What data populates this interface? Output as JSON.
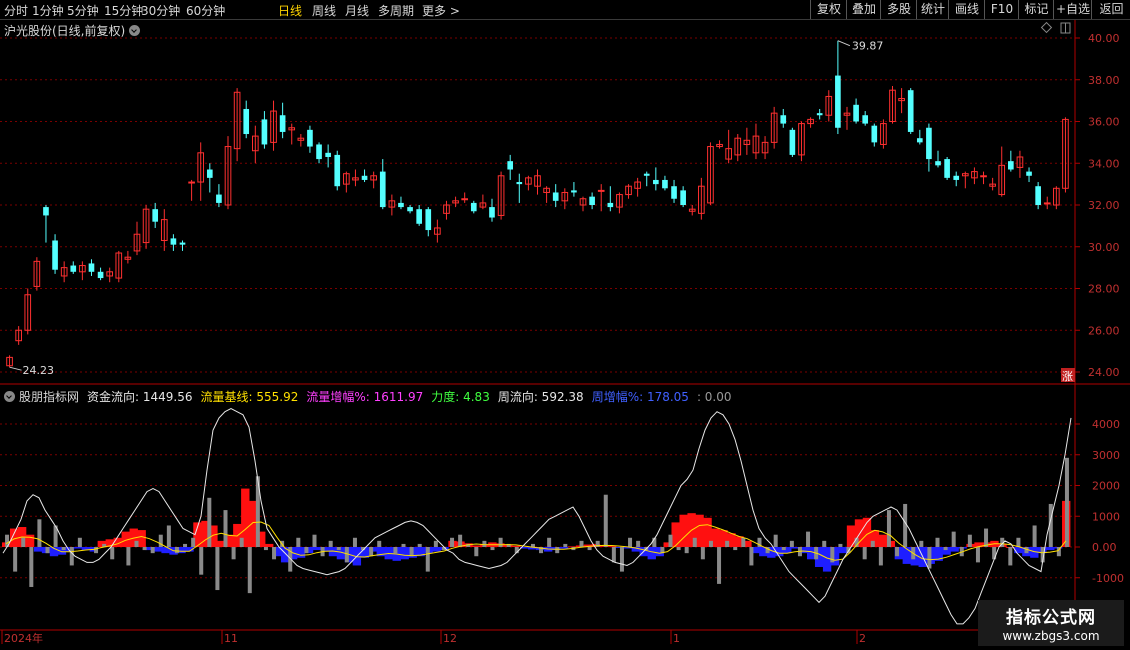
{
  "toolbar": {
    "periods": [
      "分时",
      "1分钟",
      "5分钟",
      "15分钟",
      "30分钟",
      "60分钟",
      "日线",
      "周线",
      "月线",
      "多周期",
      "更多 >"
    ],
    "active_period": "日线",
    "right_buttons": [
      "复权",
      "叠加",
      "多股",
      "统计",
      "画线",
      "F10",
      "标记",
      "+自选",
      "返回"
    ]
  },
  "main_chart": {
    "title": "沪光股份(日线,前复权)",
    "price_labels": [
      "40.00",
      "38.00",
      "36.00",
      "34.00",
      "32.00",
      "30.00",
      "28.00",
      "26.00",
      "24.00"
    ],
    "high_annotation": "39.87",
    "low_annotation": "24.23",
    "zhang_badge": "涨"
  },
  "indicator": {
    "source": "股朋指标网",
    "items": [
      {
        "label": "资金流向:",
        "value": "1449.56",
        "color": "#e6e6e6"
      },
      {
        "label": "流量基线:",
        "value": "555.92",
        "color": "#ffe000"
      },
      {
        "label": "流量增幅%:",
        "value": "1611.97",
        "color": "#ff40ff"
      },
      {
        "label": "力度:",
        "value": "4.83",
        "color": "#40ff40"
      },
      {
        "label": "周流向:",
        "value": "592.38",
        "color": "#e6e6e6"
      },
      {
        "label": "周增幅%:",
        "value": "178.05",
        "color": "#4060ff"
      },
      {
        "label": ":",
        "value": "0.00",
        "color": "#999999"
      }
    ],
    "axis_labels": [
      "4000",
      "3000",
      "2000",
      "1000",
      "0.00",
      "-1000"
    ]
  },
  "date_labels": [
    "2024年",
    "11",
    "12",
    "1",
    "2"
  ],
  "watermark": {
    "line1": "指标公式网",
    "line2": "www.zbgs3.com"
  },
  "colors": {
    "up": "#ff3030",
    "down": "#54ffff",
    "grid": "#7a0000",
    "frame": "#b00000"
  },
  "chart_data": {
    "type": "candlestick",
    "price_ylim": [
      23.5,
      40.5
    ],
    "flow_ylim": [
      -2600,
      4900
    ],
    "candles": [
      {
        "o": 24.3,
        "h": 24.8,
        "l": 24.23,
        "c": 24.7
      },
      {
        "o": 25.5,
        "h": 26.2,
        "l": 25.3,
        "c": 26.0
      },
      {
        "o": 26.0,
        "h": 28.0,
        "l": 25.8,
        "c": 27.7
      },
      {
        "o": 28.1,
        "h": 29.5,
        "l": 27.9,
        "c": 29.3
      },
      {
        "o": 31.9,
        "h": 32.0,
        "l": 30.2,
        "c": 31.5
      },
      {
        "o": 30.3,
        "h": 30.6,
        "l": 28.7,
        "c": 28.9
      },
      {
        "o": 28.6,
        "h": 29.3,
        "l": 28.3,
        "c": 29.0
      },
      {
        "o": 29.1,
        "h": 29.3,
        "l": 28.7,
        "c": 28.8
      },
      {
        "o": 28.8,
        "h": 29.3,
        "l": 28.4,
        "c": 29.1
      },
      {
        "o": 29.2,
        "h": 29.4,
        "l": 28.6,
        "c": 28.8
      },
      {
        "o": 28.8,
        "h": 29.0,
        "l": 28.4,
        "c": 28.5
      },
      {
        "o": 28.6,
        "h": 29.0,
        "l": 28.3,
        "c": 28.8
      },
      {
        "o": 28.5,
        "h": 29.8,
        "l": 28.3,
        "c": 29.7
      },
      {
        "o": 29.4,
        "h": 29.8,
        "l": 29.2,
        "c": 29.5
      },
      {
        "o": 29.8,
        "h": 31.2,
        "l": 29.6,
        "c": 30.6
      },
      {
        "o": 30.2,
        "h": 32.0,
        "l": 29.9,
        "c": 31.8
      },
      {
        "o": 31.8,
        "h": 32.1,
        "l": 30.9,
        "c": 31.2
      },
      {
        "o": 30.3,
        "h": 31.8,
        "l": 29.8,
        "c": 31.3
      },
      {
        "o": 30.4,
        "h": 30.6,
        "l": 29.8,
        "c": 30.1
      },
      {
        "o": 30.2,
        "h": 30.3,
        "l": 29.8,
        "c": 30.1
      },
      {
        "o": 33.1,
        "h": 33.2,
        "l": 32.2,
        "c": 33.1
      },
      {
        "o": 33.1,
        "h": 35.0,
        "l": 32.2,
        "c": 34.5
      },
      {
        "o": 33.7,
        "h": 34.0,
        "l": 32.6,
        "c": 33.3
      },
      {
        "o": 32.5,
        "h": 33.0,
        "l": 31.9,
        "c": 32.1
      },
      {
        "o": 32.0,
        "h": 35.3,
        "l": 31.8,
        "c": 34.8
      },
      {
        "o": 34.7,
        "h": 37.6,
        "l": 34.1,
        "c": 37.4
      },
      {
        "o": 36.6,
        "h": 37.0,
        "l": 35.2,
        "c": 35.4
      },
      {
        "o": 34.6,
        "h": 35.8,
        "l": 34.0,
        "c": 35.3
      },
      {
        "o": 36.1,
        "h": 36.5,
        "l": 34.7,
        "c": 34.9
      },
      {
        "o": 35.0,
        "h": 37.0,
        "l": 34.6,
        "c": 36.5
      },
      {
        "o": 36.3,
        "h": 36.9,
        "l": 35.2,
        "c": 35.5
      },
      {
        "o": 35.6,
        "h": 35.9,
        "l": 34.9,
        "c": 35.7
      },
      {
        "o": 35.1,
        "h": 35.4,
        "l": 34.8,
        "c": 35.2
      },
      {
        "o": 35.6,
        "h": 35.8,
        "l": 34.5,
        "c": 34.8
      },
      {
        "o": 34.9,
        "h": 35.0,
        "l": 34.0,
        "c": 34.2
      },
      {
        "o": 34.5,
        "h": 34.9,
        "l": 33.8,
        "c": 34.3
      },
      {
        "o": 34.4,
        "h": 34.6,
        "l": 32.7,
        "c": 32.9
      },
      {
        "o": 33.0,
        "h": 33.6,
        "l": 32.6,
        "c": 33.5
      },
      {
        "o": 33.2,
        "h": 33.7,
        "l": 32.9,
        "c": 33.3
      },
      {
        "o": 33.4,
        "h": 33.7,
        "l": 33.1,
        "c": 33.2
      },
      {
        "o": 33.2,
        "h": 33.6,
        "l": 32.8,
        "c": 33.4
      },
      {
        "o": 33.6,
        "h": 34.2,
        "l": 31.8,
        "c": 31.9
      },
      {
        "o": 31.9,
        "h": 32.5,
        "l": 31.5,
        "c": 32.2
      },
      {
        "o": 32.1,
        "h": 32.4,
        "l": 31.8,
        "c": 31.9
      },
      {
        "o": 31.9,
        "h": 32.0,
        "l": 31.6,
        "c": 31.7
      },
      {
        "o": 31.8,
        "h": 32.0,
        "l": 31.0,
        "c": 31.1
      },
      {
        "o": 31.8,
        "h": 31.9,
        "l": 30.5,
        "c": 30.8
      },
      {
        "o": 30.6,
        "h": 31.3,
        "l": 30.2,
        "c": 30.9
      },
      {
        "o": 31.6,
        "h": 32.2,
        "l": 31.3,
        "c": 32.0
      },
      {
        "o": 32.1,
        "h": 32.4,
        "l": 31.9,
        "c": 32.2
      },
      {
        "o": 32.3,
        "h": 32.6,
        "l": 32.1,
        "c": 32.3
      },
      {
        "o": 32.1,
        "h": 32.2,
        "l": 31.6,
        "c": 31.7
      },
      {
        "o": 31.9,
        "h": 32.5,
        "l": 31.8,
        "c": 32.1
      },
      {
        "o": 31.9,
        "h": 32.3,
        "l": 31.2,
        "c": 31.4
      },
      {
        "o": 31.5,
        "h": 33.6,
        "l": 31.3,
        "c": 33.4
      },
      {
        "o": 34.1,
        "h": 34.4,
        "l": 33.2,
        "c": 33.7
      },
      {
        "o": 33.1,
        "h": 33.5,
        "l": 32.1,
        "c": 33.0
      },
      {
        "o": 33.0,
        "h": 33.4,
        "l": 32.7,
        "c": 33.3
      },
      {
        "o": 32.9,
        "h": 33.7,
        "l": 32.5,
        "c": 33.4
      },
      {
        "o": 32.6,
        "h": 32.9,
        "l": 32.1,
        "c": 32.8
      },
      {
        "o": 32.6,
        "h": 33.0,
        "l": 31.9,
        "c": 32.2
      },
      {
        "o": 32.2,
        "h": 32.8,
        "l": 31.8,
        "c": 32.6
      },
      {
        "o": 32.7,
        "h": 33.1,
        "l": 32.4,
        "c": 32.6
      },
      {
        "o": 32.0,
        "h": 32.4,
        "l": 31.7,
        "c": 32.3
      },
      {
        "o": 32.4,
        "h": 32.6,
        "l": 31.8,
        "c": 32.0
      },
      {
        "o": 32.7,
        "h": 33.0,
        "l": 31.7,
        "c": 32.7
      },
      {
        "o": 32.1,
        "h": 32.9,
        "l": 31.7,
        "c": 31.9
      },
      {
        "o": 31.9,
        "h": 32.6,
        "l": 31.6,
        "c": 32.5
      },
      {
        "o": 32.5,
        "h": 33.0,
        "l": 32.3,
        "c": 32.9
      },
      {
        "o": 32.8,
        "h": 33.3,
        "l": 32.4,
        "c": 33.1
      },
      {
        "o": 33.5,
        "h": 33.6,
        "l": 32.9,
        "c": 33.4
      },
      {
        "o": 33.2,
        "h": 33.8,
        "l": 32.7,
        "c": 33.0
      },
      {
        "o": 33.2,
        "h": 33.4,
        "l": 32.7,
        "c": 32.8
      },
      {
        "o": 32.9,
        "h": 33.2,
        "l": 32.1,
        "c": 32.3
      },
      {
        "o": 32.7,
        "h": 32.9,
        "l": 31.9,
        "c": 32.0
      },
      {
        "o": 31.7,
        "h": 32.0,
        "l": 31.5,
        "c": 31.8
      },
      {
        "o": 31.6,
        "h": 33.3,
        "l": 31.3,
        "c": 32.9
      },
      {
        "o": 32.1,
        "h": 35.0,
        "l": 32.0,
        "c": 34.8
      },
      {
        "o": 34.8,
        "h": 35.1,
        "l": 34.7,
        "c": 34.9
      },
      {
        "o": 34.2,
        "h": 35.6,
        "l": 34.0,
        "c": 34.7
      },
      {
        "o": 34.4,
        "h": 35.4,
        "l": 34.1,
        "c": 35.2
      },
      {
        "o": 34.9,
        "h": 35.7,
        "l": 34.4,
        "c": 35.1
      },
      {
        "o": 34.5,
        "h": 35.9,
        "l": 34.2,
        "c": 35.3
      },
      {
        "o": 34.5,
        "h": 35.3,
        "l": 34.2,
        "c": 35.0
      },
      {
        "o": 35.0,
        "h": 36.7,
        "l": 34.7,
        "c": 36.4
      },
      {
        "o": 36.3,
        "h": 36.6,
        "l": 35.7,
        "c": 35.9
      },
      {
        "o": 35.6,
        "h": 35.7,
        "l": 34.3,
        "c": 34.4
      },
      {
        "o": 34.4,
        "h": 36.0,
        "l": 34.1,
        "c": 35.9
      },
      {
        "o": 35.9,
        "h": 36.2,
        "l": 35.7,
        "c": 36.1
      },
      {
        "o": 36.4,
        "h": 36.6,
        "l": 36.1,
        "c": 36.3
      },
      {
        "o": 36.3,
        "h": 37.5,
        "l": 36.0,
        "c": 37.2
      },
      {
        "o": 38.2,
        "h": 39.87,
        "l": 35.4,
        "c": 35.7
      },
      {
        "o": 36.3,
        "h": 36.7,
        "l": 35.6,
        "c": 36.4
      },
      {
        "o": 36.8,
        "h": 37.1,
        "l": 35.9,
        "c": 36.0
      },
      {
        "o": 36.3,
        "h": 36.5,
        "l": 35.8,
        "c": 35.9
      },
      {
        "o": 35.8,
        "h": 35.9,
        "l": 34.8,
        "c": 35.0
      },
      {
        "o": 34.9,
        "h": 36.1,
        "l": 34.7,
        "c": 35.9
      },
      {
        "o": 36.0,
        "h": 37.7,
        "l": 35.9,
        "c": 37.5
      },
      {
        "o": 37.0,
        "h": 37.6,
        "l": 36.4,
        "c": 37.1
      },
      {
        "o": 37.5,
        "h": 37.6,
        "l": 35.4,
        "c": 35.5
      },
      {
        "o": 35.2,
        "h": 35.6,
        "l": 34.9,
        "c": 35.0
      },
      {
        "o": 35.7,
        "h": 35.9,
        "l": 33.6,
        "c": 34.2
      },
      {
        "o": 34.1,
        "h": 34.6,
        "l": 33.8,
        "c": 33.9
      },
      {
        "o": 34.2,
        "h": 34.3,
        "l": 33.2,
        "c": 33.3
      },
      {
        "o": 33.4,
        "h": 33.6,
        "l": 32.9,
        "c": 33.2
      },
      {
        "o": 33.4,
        "h": 33.6,
        "l": 32.8,
        "c": 33.5
      },
      {
        "o": 33.3,
        "h": 33.8,
        "l": 33.0,
        "c": 33.6
      },
      {
        "o": 33.4,
        "h": 33.6,
        "l": 33.0,
        "c": 33.4
      },
      {
        "o": 32.9,
        "h": 33.3,
        "l": 32.7,
        "c": 33.0
      },
      {
        "o": 32.5,
        "h": 34.8,
        "l": 32.4,
        "c": 33.9
      },
      {
        "o": 34.1,
        "h": 34.6,
        "l": 33.6,
        "c": 33.7
      },
      {
        "o": 33.8,
        "h": 34.6,
        "l": 33.3,
        "c": 34.3
      },
      {
        "o": 33.6,
        "h": 33.8,
        "l": 33.1,
        "c": 33.4
      },
      {
        "o": 32.9,
        "h": 33.1,
        "l": 31.8,
        "c": 32.0
      },
      {
        "o": 32.1,
        "h": 32.4,
        "l": 31.8,
        "c": 32.1
      },
      {
        "o": 32.0,
        "h": 32.9,
        "l": 31.8,
        "c": 32.8
      },
      {
        "o": 32.8,
        "h": 36.2,
        "l": 32.6,
        "c": 36.1
      }
    ],
    "flow_bars": [
      150,
      600,
      650,
      400,
      -150,
      -200,
      -300,
      -250,
      -150,
      -50,
      -100,
      -150,
      200,
      250,
      300,
      500,
      600,
      550,
      -100,
      -150,
      -200,
      -250,
      -200,
      -150,
      800,
      850,
      700,
      200,
      400,
      750,
      1900,
      1500,
      500,
      100,
      -300,
      -500,
      -400,
      -350,
      -200,
      -100,
      -150,
      -300,
      -400,
      -500,
      -600,
      -350,
      -150,
      -300,
      -400,
      -450,
      -400,
      -350,
      -300,
      -200,
      -150,
      -100,
      200,
      180,
      120,
      50,
      100,
      150,
      120,
      80,
      40,
      -50,
      -80,
      -100,
      -150,
      -100,
      -50,
      20,
      50,
      80,
      100,
      60,
      30,
      -20,
      -50,
      -150,
      -300,
      -400,
      -300,
      150,
      800,
      1050,
      1100,
      1050,
      950,
      600,
      550,
      450,
      350,
      200,
      -200,
      -300,
      -350,
      -300,
      -200,
      -50,
      -200,
      -400,
      -650,
      -800,
      -600,
      -200,
      700,
      900,
      950,
      550,
      400,
      200,
      -400,
      -550,
      -600,
      -650,
      -550,
      -450,
      -250,
      -150,
      -50,
      100,
      150,
      150,
      200,
      100,
      0,
      -200,
      -300,
      -350,
      -200,
      -100,
      -50,
      1500
    ],
    "gray_bars": [
      400,
      -800,
      300,
      -1300,
      900,
      -200,
      700,
      -100,
      -600,
      300,
      0,
      -200,
      100,
      -400,
      0,
      -600,
      200,
      -100,
      -200,
      400,
      700,
      -200,
      100,
      300,
      -900,
      1600,
      -1400,
      1200,
      -400,
      300,
      -1500,
      2300,
      -100,
      -400,
      200,
      -800,
      300,
      -200,
      400,
      -300,
      200,
      -100,
      -500,
      300,
      -100,
      -300,
      200,
      0,
      -200,
      100,
      -300,
      100,
      -800,
      200,
      -100,
      300,
      400,
      100,
      -300,
      200,
      -100,
      300,
      100,
      -200,
      0,
      100,
      -200,
      300,
      -200,
      100,
      -100,
      200,
      -100,
      200,
      1700,
      -500,
      -800,
      300,
      200,
      -100,
      300,
      -200,
      400,
      -100,
      -200,
      300,
      -400,
      200,
      -1200,
      200,
      -100,
      300,
      -600,
      300,
      -200,
      400,
      -100,
      200,
      -300,
      500,
      -400,
      200,
      -500,
      100,
      -200,
      300,
      -400,
      200,
      -600,
      1200,
      -300,
      1400,
      -400,
      200,
      -700,
      300,
      -100,
      500,
      -300,
      400,
      -500,
      600,
      -400,
      300,
      -600,
      300,
      -200,
      700,
      -500,
      1400,
      -300,
      2900
    ],
    "white_line": [
      -200,
      100,
      500,
      900,
      1500,
      1700,
      1600,
      1200,
      900,
      600,
      200,
      -100,
      -300,
      -400,
      -500,
      -500,
      -400,
      -200,
      0,
      300,
      600,
      900,
      1200,
      1500,
      1800,
      1900,
      1800,
      1500,
      1200,
      900,
      600,
      500,
      400,
      1000,
      2500,
      3800,
      4200,
      4400,
      4500,
      4400,
      4300,
      3900,
      2800,
      1500,
      600,
      300,
      0,
      -200,
      -400,
      -600,
      -700,
      -750,
      -800,
      -850,
      -900,
      -850,
      -800,
      -700,
      -500,
      -300,
      -100,
      100,
      300,
      400,
      500,
      600,
      700,
      800,
      850,
      800,
      700,
      500,
      300,
      100,
      -100,
      -200,
      -400,
      -500,
      -550,
      -600,
      -650,
      -700,
      -650,
      -600,
      -500,
      -300,
      -100,
      100,
      300,
      500,
      700,
      900,
      1000,
      1100,
      1200,
      1300,
      1000,
      600,
      200,
      -100,
      -300,
      -400,
      -500,
      -550,
      -600,
      -500,
      -300,
      -100,
      100,
      400,
      800,
      1200,
      1600,
      2000,
      2200,
      2500,
      3200,
      3800,
      4200,
      4400,
      4300,
      4000,
      3500,
      2800,
      2000,
      1200,
      600,
      300,
      100,
      -200,
      -500,
      -800,
      -1000,
      -1200,
      -1400,
      -1600,
      -1800,
      -1600,
      -1200,
      -800,
      -400,
      -100,
      200,
      500,
      800,
      1000,
      1100,
      1200,
      1300,
      1200,
      900,
      600,
      200,
      -200,
      -600,
      -1000,
      -1400,
      -1800,
      -2200,
      -2500,
      -2500,
      -2300,
      -2000,
      -1500,
      -1000,
      -500,
      0,
      200,
      100,
      -200,
      -400,
      -600,
      -700,
      -800,
      400,
      1200,
      2000,
      3000,
      4200
    ]
  }
}
